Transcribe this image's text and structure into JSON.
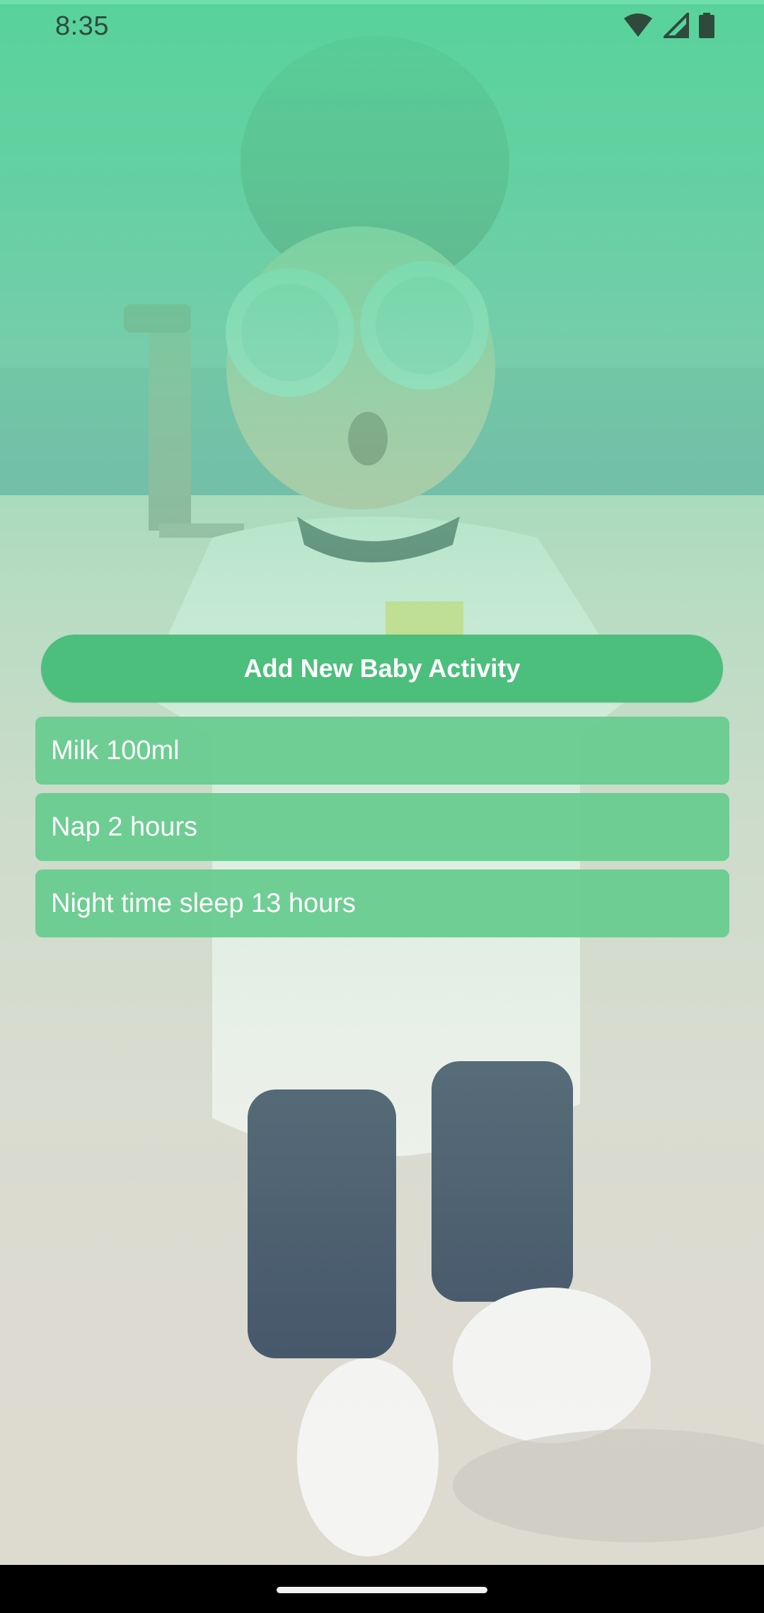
{
  "status_bar": {
    "time": "8:35",
    "icons": [
      "wifi-icon",
      "signal-icon",
      "battery-icon"
    ]
  },
  "background": {
    "description_icon": "baby-photo",
    "tint_color": "#58d49b"
  },
  "main": {
    "add_button_label": "Add New Baby Activity",
    "activities": [
      {
        "label": "Milk 100ml"
      },
      {
        "label": "Nap 2 hours"
      },
      {
        "label": "Night time sleep 13 hours"
      }
    ]
  },
  "colors": {
    "button": "#4cbf7d",
    "list_item": "#65cb8d",
    "text_on_green": "#ffffff"
  }
}
